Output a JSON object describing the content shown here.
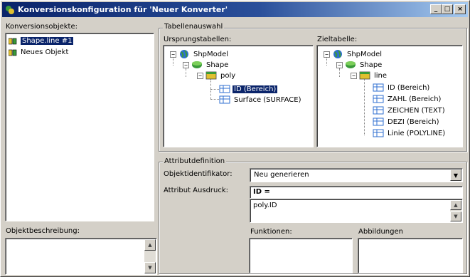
{
  "window": {
    "title": "Konversionskonfiguration für 'Neuer Konverter'",
    "buttons": {
      "minimize": "_",
      "maximize": "□",
      "close": "×"
    }
  },
  "left": {
    "objects_label": "Konversionsobjekte:",
    "objects": [
      {
        "label": "Shape.line #1",
        "icon": "conversion-object-icon",
        "selected": true
      },
      {
        "label": "Neues Objekt",
        "icon": "conversion-object-icon",
        "selected": false
      }
    ],
    "description_label": "Objektbeschreibung:",
    "description_value": ""
  },
  "table_selection": {
    "title": "Tabellenauswahl",
    "source_label": "Ursprungstabellen:",
    "target_label": "Zieltabelle:",
    "source_tree": {
      "root": "ShpModel",
      "level1": "Shape",
      "level2": "poly",
      "leaves": [
        {
          "label": "ID (Bereich)",
          "selected": true
        },
        {
          "label": "Surface (SURFACE)",
          "selected": false
        }
      ]
    },
    "target_tree": {
      "root": "ShpModel",
      "level1": "Shape",
      "level2": "line",
      "leaves": [
        {
          "label": "ID (Bereich)"
        },
        {
          "label": "ZAHL (Bereich)"
        },
        {
          "label": "ZEICHEN (TEXT)"
        },
        {
          "label": "DEZI (Bereich)"
        },
        {
          "label": "Linie (POLYLINE)"
        }
      ]
    }
  },
  "attribute_definition": {
    "title": "Attributdefinition",
    "object_identifier_label": "Objektidentifikator:",
    "object_identifier_value": "Neu generieren",
    "attribute_expression_label": "Attribut Ausdruck:",
    "attribute_expression_header": "ID =",
    "attribute_expression_value": "poly.ID",
    "functions_label": "Funktionen:",
    "mappings_label": "Abbildungen"
  },
  "colors": {
    "title_bar_start": "#0a246a",
    "title_bar_end": "#a6caf0",
    "selection": "#0a246a",
    "face": "#d4d0c8"
  }
}
